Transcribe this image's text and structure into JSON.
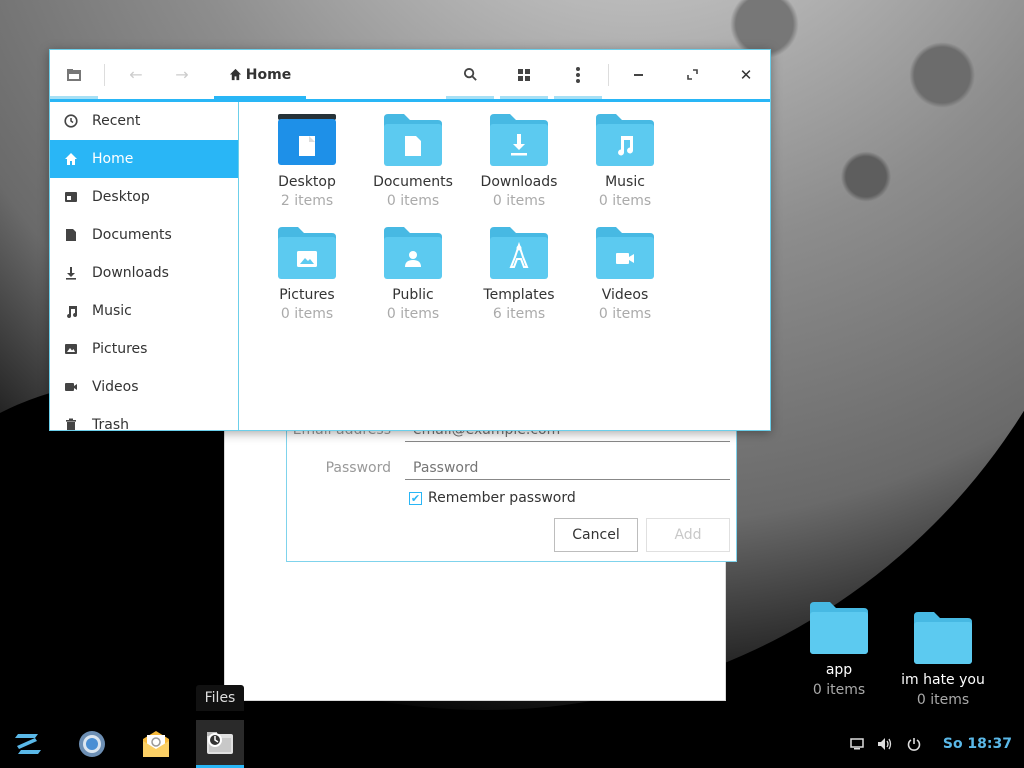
{
  "files_window": {
    "breadcrumb": "Home",
    "sidebar": [
      {
        "label": "Recent",
        "icon": "clock-icon",
        "active": false
      },
      {
        "label": "Home",
        "icon": "home-icon",
        "active": true
      },
      {
        "label": "Desktop",
        "icon": "desktop-icon",
        "active": false
      },
      {
        "label": "Documents",
        "icon": "document-icon",
        "active": false
      },
      {
        "label": "Downloads",
        "icon": "download-icon",
        "active": false
      },
      {
        "label": "Music",
        "icon": "music-icon",
        "active": false
      },
      {
        "label": "Pictures",
        "icon": "picture-icon",
        "active": false
      },
      {
        "label": "Videos",
        "icon": "video-icon",
        "active": false
      },
      {
        "label": "Trash",
        "icon": "trash-icon",
        "active": false
      }
    ],
    "folders": [
      {
        "name": "Desktop",
        "count": "2 items",
        "emblem": "desktop"
      },
      {
        "name": "Documents",
        "count": "0 items",
        "emblem": "document"
      },
      {
        "name": "Downloads",
        "count": "0 items",
        "emblem": "download"
      },
      {
        "name": "Music",
        "count": "0 items",
        "emblem": "music"
      },
      {
        "name": "Pictures",
        "count": "0 items",
        "emblem": "picture"
      },
      {
        "name": "Public",
        "count": "0 items",
        "emblem": "person"
      },
      {
        "name": "Templates",
        "count": "6 items",
        "emblem": "template"
      },
      {
        "name": "Videos",
        "count": "0 items",
        "emblem": "video"
      }
    ]
  },
  "account_dialog": {
    "email_label": "Email address",
    "email_placeholder": "email@example.com",
    "password_label": "Password",
    "password_placeholder": "Password",
    "remember_label": "Remember password",
    "remember_checked": true,
    "cancel_label": "Cancel",
    "add_label": "Add"
  },
  "desktop_icons": [
    {
      "name": "app",
      "count": "0 items"
    },
    {
      "name": "im hate you",
      "count": "0 items"
    }
  ],
  "panel": {
    "tooltip": "Files",
    "clock": "So 18:37"
  },
  "colors": {
    "accent": "#29b6f6",
    "folder": "#5ccaf0",
    "folder_tab": "#47b9e3"
  }
}
